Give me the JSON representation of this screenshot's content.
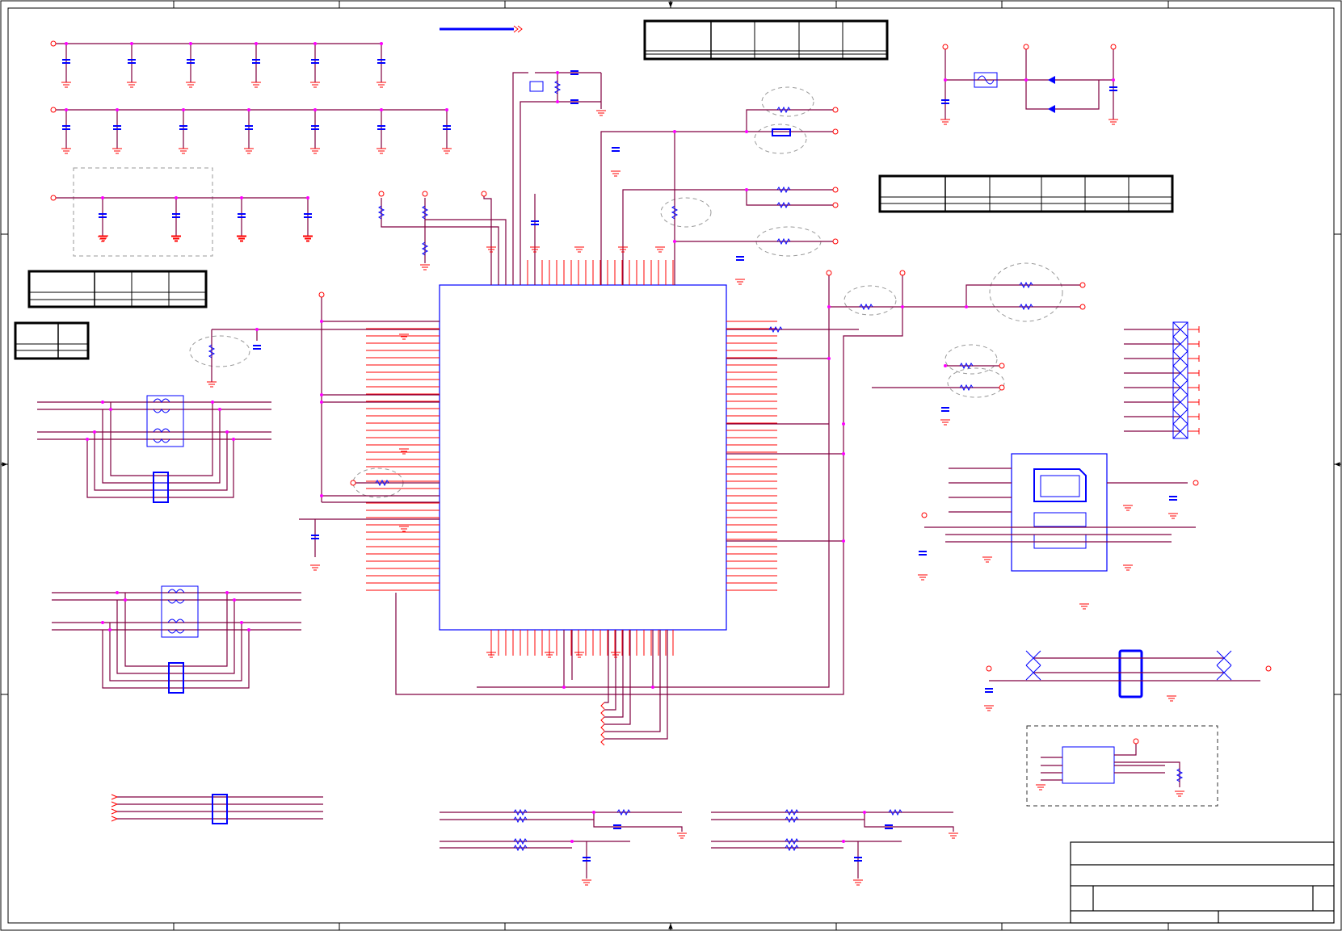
{
  "sheet": {
    "title_block": {
      "rows": [
        "",
        "",
        ""
      ]
    }
  },
  "colors": {
    "net_wire": "#800040",
    "pin_wire": "#ff0000",
    "component": "#0000ff",
    "junction": "#ff00ff",
    "frame": "#000000",
    "dashed_outline": "#999999"
  },
  "icons": {
    "ic_main": "qfp-chip-outline",
    "transformer": "magnetic-transformer-symbol",
    "sim_socket": "sim-card-socket",
    "connector": "pin-header-connector",
    "crystal": "crystal-oscillator",
    "ground": "ground-symbol"
  }
}
